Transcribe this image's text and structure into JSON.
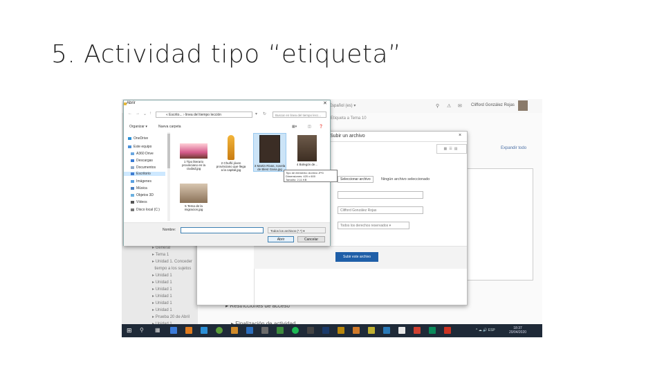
{
  "slide": {
    "title": "5. Actividad tipo “etiqueta”"
  },
  "moodle": {
    "header_text": "Español (es) ▾",
    "user_name": "Clifford González Rojas",
    "breadcrumb": "Etiqueta a Tema 10",
    "expand_all": "Expandir todo",
    "nav_items": [
      "General",
      "Tema 1",
      "Unidad 1. Conceder",
      "tiempo a los sujetos",
      "Unidad 1",
      "Unidad 1",
      "Unidad 1",
      "Unidad 1",
      "Unidad 1",
      "Unidad 1",
      "Prueba 20 de Abril",
      "Unidad 1"
    ],
    "restrictions": "Restricciones de acceso",
    "completion": "Finalización de actividad"
  },
  "picker": {
    "title": "Subir un archivo",
    "choose_button": "Seleccionar archivo",
    "no_file_text": "Ningún archivo seleccionado",
    "author_value": "Clifford González Rojas",
    "license_value": "Todos los derechos reservados",
    "upload_button": "Subir este archivo",
    "close": "×"
  },
  "open_dialog": {
    "title": "Abrir",
    "address": "« Escrito... › linea del tiempo lección",
    "search_placeholder": "Buscar en linea del tiempo lecc...",
    "organize": "Organizar ▾",
    "new_folder": "Nueva carpeta",
    "tree": [
      "OneDrive",
      "Este equipo",
      "A360 Drive",
      "Descargas",
      "Documentos",
      "Escritorio",
      "Imágenes",
      "Música",
      "Objetos 3D",
      "Vídeos",
      "Disco local (C:)"
    ],
    "files": [
      {
        "name": "1 Tipo literario provinciano en la ciudad.jpg"
      },
      {
        "name": "2 Chulfó jóven provinciano que llega a la capital.jpg"
      },
      {
        "name": "3 Martin Rivas, novela de Blest Gana.jpg"
      },
      {
        "name": "4 Bolegón de..."
      },
      {
        "name": "5 Tema de la migracion.jpg"
      }
    ],
    "tooltip": [
      "Tipo de elemento: Archivo JPG",
      "Dimensiones: 420 x 600",
      "Tamaño: 2,11 KB"
    ],
    "filename_label": "Nombre:",
    "filetype": "Todos los archivos (*.*)",
    "open_button": "Abrir",
    "cancel_button": "Cancelar"
  },
  "taskbar": {
    "lang": "ESP",
    "time": "18:37",
    "date": "20/04/2020",
    "colors": [
      "#3b7bd9",
      "#e07b1e",
      "#2b8fd6",
      "#5b9e3a",
      "#1db954",
      "#6b6b6b",
      "#2c6ebd",
      "#b8860b",
      "#d04030",
      "#d94a2b",
      "#cc3322"
    ]
  }
}
